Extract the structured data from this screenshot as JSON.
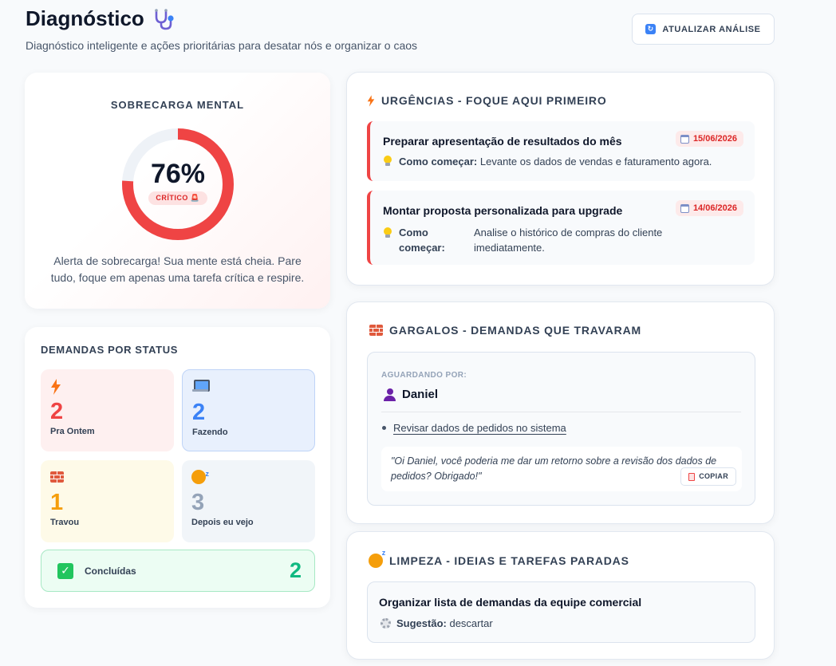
{
  "header": {
    "title": "Diagnóstico",
    "subtitle": "Diagnóstico inteligente e ações prioritárias para desatar nós e organizar o caos",
    "refresh_label": "ATUALIZAR ANÁLISE"
  },
  "overload": {
    "title": "SOBRECARGA MENTAL",
    "value_label": "76%",
    "value": 76,
    "badge": "CRÍTICO",
    "message": "Alerta de sobrecarga! Sua mente está cheia. Pare tudo, foque em apenas uma tarefa crítica e respire.",
    "color": "#ef4444"
  },
  "status": {
    "title": "DEMANDAS POR STATUS",
    "tiles": [
      {
        "count": "2",
        "label": "Pra Ontem",
        "color": "#ef4444",
        "icon": "lightning-icon"
      },
      {
        "count": "2",
        "label": "Fazendo",
        "color": "#3b82f6",
        "icon": "laptop-icon"
      },
      {
        "count": "1",
        "label": "Travou",
        "color": "#f59e0b",
        "icon": "brick-icon"
      },
      {
        "count": "3",
        "label": "Depois eu vejo",
        "color": "#94a3b8",
        "icon": "sleeping-face-icon"
      }
    ],
    "done": {
      "label": "Concluídas",
      "count": "2",
      "color": "#10b981"
    }
  },
  "urgencies": {
    "title": "URGÊNCIAS - FOQUE AQUI PRIMEIRO",
    "how_label": "Como começar:",
    "items": [
      {
        "name": "Preparar apresentação de resultados do mês",
        "date": "15/06/2026",
        "how": "Levante os dados de vendas e faturamento agora."
      },
      {
        "name": "Montar proposta personalizada para upgrade",
        "date": "14/06/2026",
        "how": "Analise o histórico de compras do cliente imediatamente."
      }
    ]
  },
  "bottlenecks": {
    "title": "GARGALOS - DEMANDAS QUE TRAVARAM",
    "waiting_label": "AGUARDANDO POR:",
    "person": "Daniel",
    "task": "Revisar dados de pedidos no sistema",
    "message": "\"Oi Daniel, você poderia me dar um retorno sobre a revisão dos dados de pedidos? Obrigado!\"",
    "copy_label": "COPIAR"
  },
  "cleanup": {
    "title": "LIMPEZA - IDEIAS E TAREFAS PARADAS",
    "item_name": "Organizar lista de demandas da equipe comercial",
    "suggestion_label": "Sugestão:",
    "suggestion_value": "descartar"
  }
}
